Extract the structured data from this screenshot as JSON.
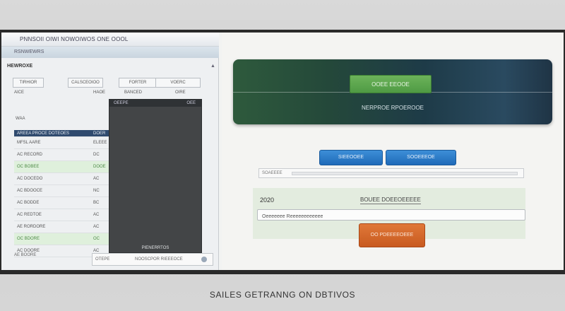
{
  "window": {
    "title": "PNNSOII OIWI NOWOIWOS ONE OOOL",
    "subtitle": "RSNWEWRS"
  },
  "left_panel": {
    "section_label": "HEWROXE",
    "scroll_icon": "scroll-up-icon",
    "filters": [
      "TIRHIOR",
      "CALSCEOIOO",
      "FORTER"
    ],
    "columns": {
      "col_a": "AICE",
      "col_b": "HAOE",
      "col_c": "BANCED",
      "col_d": "VOERC",
      "col_e": "WAA",
      "col_f": "OIRE"
    },
    "rows": [
      {
        "c1": "AREEA PROCE DOTEOES",
        "c2": "DOER",
        "state": "header"
      },
      {
        "c1": "MFSL  AARE",
        "c2": "ELEEE",
        "state": "normal"
      },
      {
        "c1": "AC RECORD",
        "c2": "DC",
        "state": "normal"
      },
      {
        "c1": "OC BOBEE",
        "c2": "DOOE",
        "state": "selected"
      },
      {
        "c1": "AC DOCEDO",
        "c2": "AC",
        "state": "normal"
      },
      {
        "c1": "AC BDOOCE",
        "c2": "NC",
        "state": "normal"
      },
      {
        "c1": "AC BODDE",
        "c2": "BC",
        "state": "normal"
      },
      {
        "c1": "AC REDTOE",
        "c2": "AC",
        "state": "normal"
      },
      {
        "c1": "AE RORDORE",
        "c2": "AC",
        "state": "normal"
      },
      {
        "c1": "OC BDORE",
        "c2": "OC",
        "state": "selected"
      },
      {
        "c1": "AC DOORE",
        "c2": "AC",
        "state": "normal"
      }
    ],
    "dark_list": {
      "header_left": "OEEPE",
      "header_right": "OEE",
      "footer": "PIENERRTOS"
    },
    "bottom_label": "AE BOORE",
    "status": {
      "left": "OTEPE",
      "right": "NOOSCPOR RIEEEOCE"
    }
  },
  "right_panel": {
    "banner": {
      "button_label": "OOEE EEOOE",
      "subtitle": "NERPROE RPOEROOE"
    },
    "buttons": [
      {
        "label": "SIEEOOEE"
      },
      {
        "label": "SOOEEEOE"
      }
    ],
    "slider": {
      "label": "SOAEEEE"
    },
    "form": {
      "year": "2020",
      "link": "BOUEE DOEEOEEEEE",
      "input_value": "Oeeeeeee Reeeeeeeeeeee"
    },
    "submit_label": "OO PDEEEEOEEE"
  },
  "caption": "SAILES GETRANNG ON DBTIVOS",
  "colors": {
    "banner_green": "#2e5a3c",
    "accent_green": "#5aa64b",
    "accent_blue": "#2a7cc8",
    "accent_orange": "#d46a2a",
    "header_navy": "#2f4a6e"
  }
}
